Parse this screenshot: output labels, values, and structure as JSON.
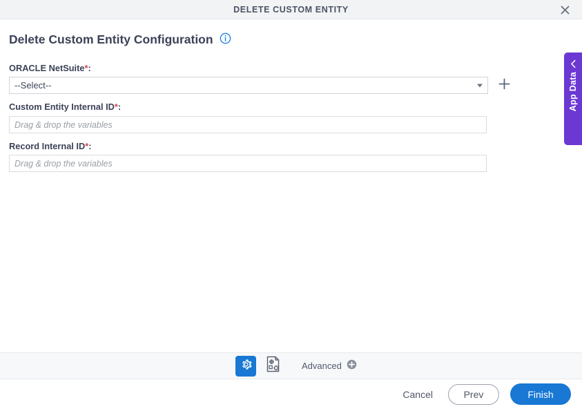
{
  "window": {
    "title": "DELETE CUSTOM ENTITY",
    "close_icon": "close-icon"
  },
  "page": {
    "heading": "Delete Custom Entity Configuration",
    "info_icon": "info-icon"
  },
  "form": {
    "fields": [
      {
        "label": "ORACLE NetSuite",
        "required": "*",
        "colon": ":",
        "type": "select",
        "value": "--Select--",
        "add_icon": "plus-icon"
      },
      {
        "label": "Custom Entity Internal ID",
        "required": "*",
        "colon": ":",
        "type": "text",
        "value": "",
        "placeholder": "Drag & drop the variables"
      },
      {
        "label": "Record Internal ID",
        "required": "*",
        "colon": ":",
        "type": "text",
        "value": "",
        "placeholder": "Drag & drop the variables"
      }
    ]
  },
  "app_data_tab": {
    "label": "App Data",
    "chevron_icon": "chevron-left-icon"
  },
  "toolbar": {
    "gear_icon": "gear-icon",
    "form_settings_icon": "form-settings-icon",
    "advanced_label": "Advanced",
    "advanced_add_icon": "plus-circle-icon"
  },
  "footer": {
    "cancel_label": "Cancel",
    "prev_label": "Prev",
    "finish_label": "Finish"
  },
  "colors": {
    "accent_blue": "#1878d4",
    "purple": "#6b38d4",
    "required_red": "#d64550",
    "header_bg": "#f1f3f5",
    "toolbar_bg": "#f7f8fa"
  }
}
